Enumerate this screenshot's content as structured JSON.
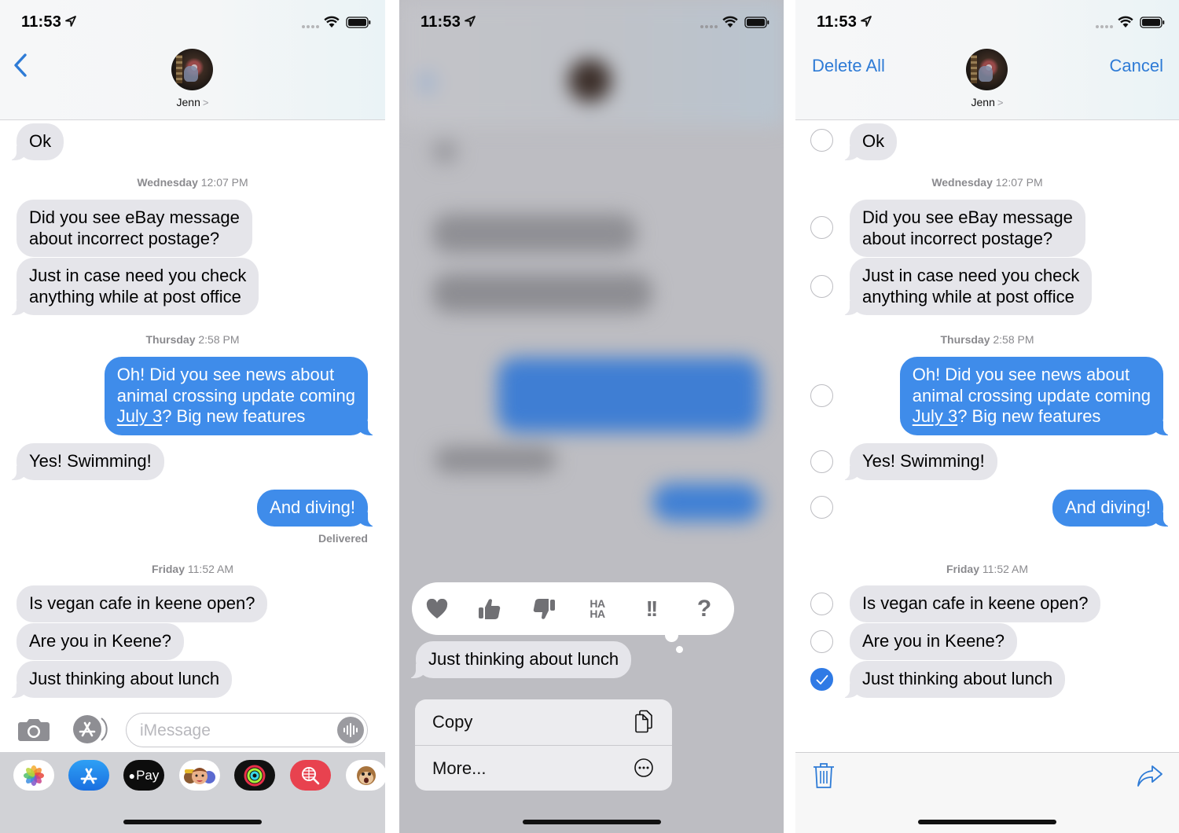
{
  "status_bar": {
    "time": "11:53"
  },
  "contact": {
    "name": "Jenn",
    "chevron": ">"
  },
  "colors": {
    "accent": "#2e7bd6",
    "outgoing_bubble": "#3f8cea",
    "incoming_bubble": "#e5e5ea",
    "selected": "#2f7ae5"
  },
  "conversation": {
    "timestamps": [
      {
        "day": "Wednesday",
        "time": "12:07 PM"
      },
      {
        "day": "Thursday",
        "time": "2:58 PM"
      },
      {
        "day": "Friday",
        "time": "11:52 AM"
      }
    ],
    "messages": [
      {
        "text": "Ok",
        "direction": "incoming"
      },
      {
        "line1": "Did you see eBay message",
        "line2": "about incorrect postage?",
        "direction": "incoming"
      },
      {
        "line1": "Just in case need you check",
        "line2": "anything while at post office",
        "direction": "incoming"
      },
      {
        "line1": "Oh! Did you see news about",
        "line2": "animal crossing update coming",
        "line3_link": "July 3",
        "line3_rest": "? Big new features",
        "direction": "outgoing"
      },
      {
        "text": "Yes! Swimming!",
        "direction": "incoming"
      },
      {
        "text": "And diving!",
        "direction": "outgoing"
      },
      {
        "text": "Is vegan cafe in keene open?",
        "direction": "incoming"
      },
      {
        "text": "Are you in Keene?",
        "direction": "incoming"
      },
      {
        "text": "Just thinking about lunch",
        "direction": "incoming"
      }
    ],
    "delivered_label": "Delivered"
  },
  "left_panel": {
    "input": {
      "placeholder": "iMessage",
      "value": ""
    },
    "app_drawer": [
      {
        "name": "Photos",
        "icon": "photos-icon"
      },
      {
        "name": "App Store",
        "icon": "app-store-icon"
      },
      {
        "name": "Apple Pay",
        "icon": "apple-pay-icon",
        "label": "Pay"
      },
      {
        "name": "Memoji",
        "icon": "memoji-icon"
      },
      {
        "name": "Activity",
        "icon": "activity-rings-icon"
      },
      {
        "name": "Images Search",
        "icon": "globe-search-icon"
      },
      {
        "name": "Animoji",
        "icon": "monkey-animoji-icon"
      }
    ]
  },
  "middle_panel": {
    "reactions": [
      {
        "name": "heart",
        "icon": "heart-icon"
      },
      {
        "name": "thumbs-up",
        "icon": "thumbs-up-icon"
      },
      {
        "name": "thumbs-down",
        "icon": "thumbs-down-icon"
      },
      {
        "name": "haha",
        "icon": "haha-icon",
        "line1": "HA",
        "line2": "HA"
      },
      {
        "name": "emphasize",
        "icon": "double-exclamation-icon",
        "label": "!!"
      },
      {
        "name": "question",
        "icon": "question-icon",
        "label": "?"
      }
    ],
    "focused_message": "Just thinking about lunch",
    "context_menu": [
      {
        "label": "Copy",
        "icon": "copy-icon"
      },
      {
        "label": "More...",
        "icon": "more-ellipsis-icon"
      }
    ]
  },
  "right_panel": {
    "delete_all_label": "Delete All",
    "cancel_label": "Cancel",
    "selection": [
      false,
      false,
      false,
      false,
      false,
      false,
      false,
      false,
      true
    ]
  }
}
